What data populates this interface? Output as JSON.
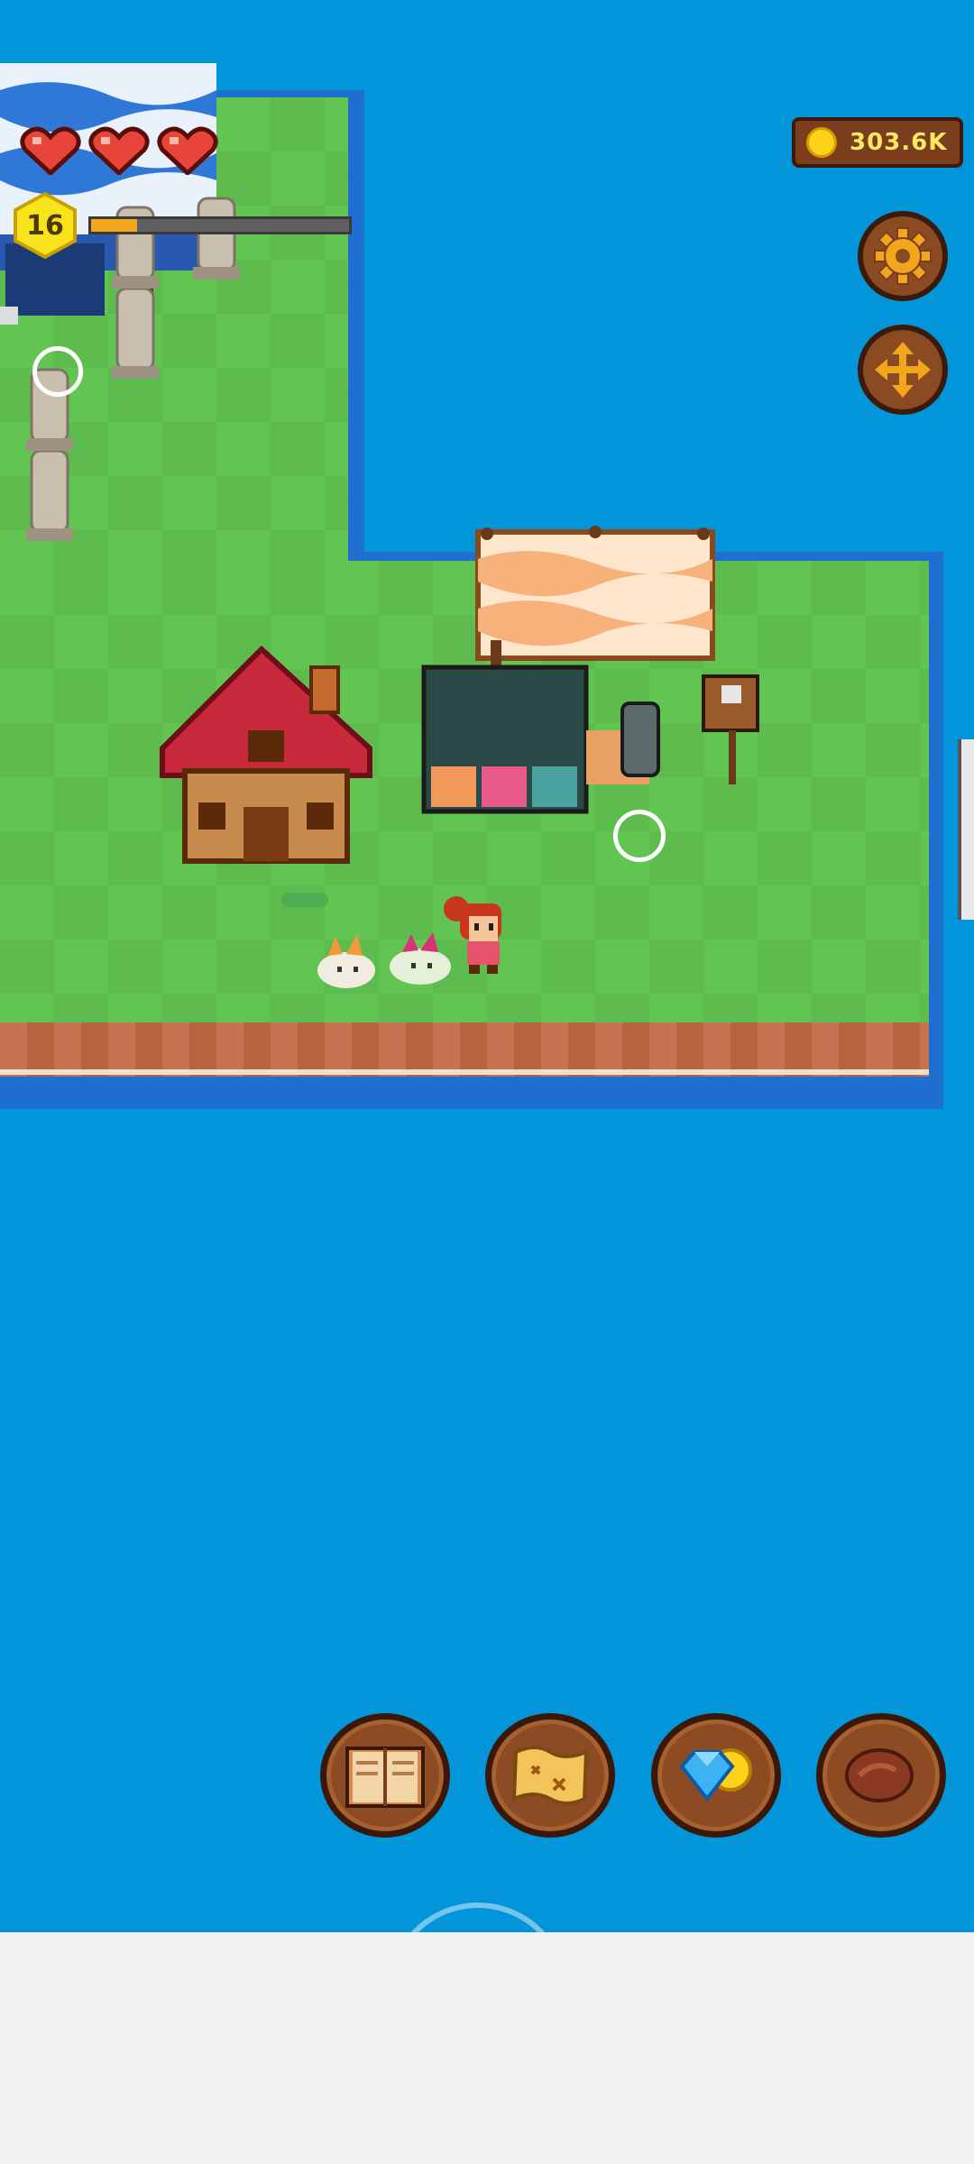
{
  "hud": {
    "coins": "303.6K",
    "level": "16",
    "hearts": 3,
    "xp_fraction": 0.18
  },
  "buttons": {
    "settings_icon": "gear-icon",
    "move_icon": "move-arrows-icon",
    "bottom": [
      {
        "name": "book-button",
        "icon": "book-icon"
      },
      {
        "name": "map-button",
        "icon": "treasure-map-icon"
      },
      {
        "name": "shop-button",
        "icon": "gem-coin-icon"
      },
      {
        "name": "meat-button",
        "icon": "meat-icon"
      }
    ]
  },
  "colors": {
    "water": "#0295da",
    "grass": "#62c451",
    "coin": "#ffd21a",
    "button_wood": "#8d4b24"
  }
}
